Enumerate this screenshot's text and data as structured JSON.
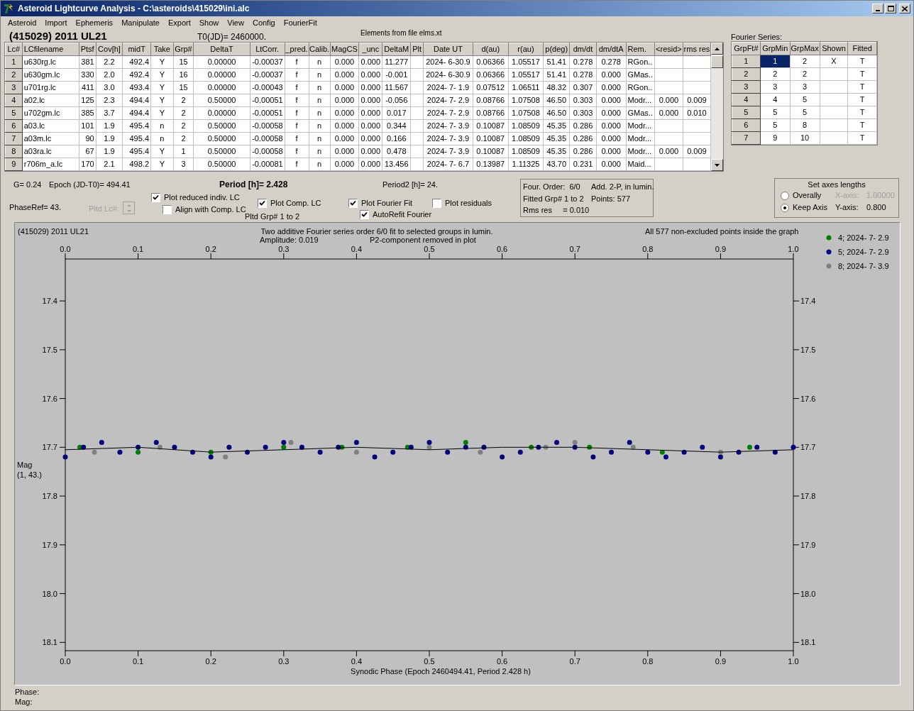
{
  "window": {
    "title": "Asteroid Lightcurve Analysis - C:\\asteroids\\415029\\ini.alc"
  },
  "menu": [
    "Asteroid",
    "Import",
    "Ephemeris",
    "Manipulate",
    "Export",
    "Show",
    "View",
    "Config",
    "FourierFit"
  ],
  "object_name": "(415029) 2011 UL21",
  "t0": "T0(JD)= 2460000.",
  "elements_note": "Elements from file elms.xt",
  "lc_table": {
    "columns": [
      "Lc#",
      "LCfilename",
      "Ptsf",
      "Cov[h]",
      "midT",
      "Take",
      "Grp#",
      "DeltaT",
      "LtCorr.",
      "_pred.",
      "Calib.",
      "MagCS",
      "_unc",
      "DeltaM",
      "Plt",
      "Date UT",
      "d(au)",
      "r(au)",
      "p(deg)",
      "dm/dt",
      "dm/dtA",
      "Rem.",
      "<resid>",
      "rms res"
    ],
    "rows": [
      [
        "1",
        "u630rg.lc",
        "381",
        "2.2",
        "492.4",
        "Y",
        "15",
        "0.00000",
        "-0.00037",
        "f",
        "n",
        "0.000",
        "0.000",
        "11.277",
        "",
        "2024- 6-30.9",
        "0.06366",
        "1.05517",
        "51.41",
        "0.278",
        "0.278",
        "RGon..",
        "",
        ""
      ],
      [
        "2",
        "u630gm.lc",
        "330",
        "2.0",
        "492.4",
        "Y",
        "16",
        "0.00000",
        "-0.00037",
        "f",
        "n",
        "0.000",
        "0.000",
        "-0.001",
        "",
        "2024- 6-30.9",
        "0.06366",
        "1.05517",
        "51.41",
        "0.278",
        "0.000",
        "GMas..",
        "",
        ""
      ],
      [
        "3",
        "u701rg.lc",
        "411",
        "3.0",
        "493.4",
        "Y",
        "15",
        "0.00000",
        "-0.00043",
        "f",
        "n",
        "0.000",
        "0.000",
        "11.567",
        "",
        "2024- 7- 1.9",
        "0.07512",
        "1.06511",
        "48.32",
        "0.307",
        "0.000",
        "RGon..",
        "",
        ""
      ],
      [
        "4",
        "a02.lc",
        "125",
        "2.3",
        "494.4",
        "Y",
        "2",
        "0.50000",
        "-0.00051",
        "f",
        "n",
        "0.000",
        "0.000",
        "-0.056",
        "",
        "2024- 7- 2.9",
        "0.08766",
        "1.07508",
        "46.50",
        "0.303",
        "0.000",
        "Modr...",
        "0.000",
        "0.009"
      ],
      [
        "5",
        "u702gm.lc",
        "385",
        "3.7",
        "494.4",
        "Y",
        "2",
        "0.00000",
        "-0.00051",
        "f",
        "n",
        "0.000",
        "0.000",
        "0.017",
        "",
        "2024- 7- 2.9",
        "0.08766",
        "1.07508",
        "46.50",
        "0.303",
        "0.000",
        "GMas..",
        "0.000",
        "0.010"
      ],
      [
        "6",
        "a03.lc",
        "101",
        "1.9",
        "495.4",
        "n",
        "2",
        "0.50000",
        "-0.00058",
        "f",
        "n",
        "0.000",
        "0.000",
        "0.344",
        "",
        "2024- 7- 3.9",
        "0.10087",
        "1.08509",
        "45.35",
        "0.286",
        "0.000",
        "Modr...",
        "",
        ""
      ],
      [
        "7",
        "a03m.lc",
        "90",
        "1.9",
        "495.4",
        "n",
        "2",
        "0.50000",
        "-0.00058",
        "f",
        "n",
        "0.000",
        "0.000",
        "0.166",
        "",
        "2024- 7- 3.9",
        "0.10087",
        "1.08509",
        "45.35",
        "0.286",
        "0.000",
        "Modr...",
        "",
        ""
      ],
      [
        "8",
        "a03ra.lc",
        "67",
        "1.9",
        "495.4",
        "Y",
        "1",
        "0.50000",
        "-0.00058",
        "f",
        "n",
        "0.000",
        "0.000",
        "0.478",
        "",
        "2024- 7- 3.9",
        "0.10087",
        "1.08509",
        "45.35",
        "0.286",
        "0.000",
        "Modr...",
        "0.000",
        "0.009"
      ],
      [
        "9",
        "r706m_a.lc",
        "170",
        "2.1",
        "498.2",
        "Y",
        "3",
        "0.50000",
        "-0.00081",
        "f",
        "n",
        "0.000",
        "0.000",
        "13.456",
        "",
        "2024- 7- 6.7",
        "0.13987",
        "1.11325",
        "43.70",
        "0.231",
        "0.000",
        "Maid...",
        "",
        ""
      ]
    ]
  },
  "fourier": {
    "label": "Fourier Series:",
    "columns": [
      "GrpFt#",
      "GrpMin",
      "GrpMax",
      "Shown",
      "Fitted"
    ],
    "rows": [
      [
        {
          "text": "1",
          "selected": false
        },
        {
          "text": "1",
          "selected": true
        },
        {
          "text": "2",
          "selected": false
        },
        {
          "text": "X",
          "selected": false
        },
        {
          "text": "T",
          "selected": false
        }
      ],
      [
        {
          "text": "2",
          "selected": false
        },
        {
          "text": "2",
          "selected": false
        },
        {
          "text": "2",
          "selected": false
        },
        {
          "text": "",
          "selected": false
        },
        {
          "text": "T",
          "selected": false
        }
      ],
      [
        {
          "text": "3",
          "selected": false
        },
        {
          "text": "3",
          "selected": false
        },
        {
          "text": "3",
          "selected": false
        },
        {
          "text": "",
          "selected": false
        },
        {
          "text": "T",
          "selected": false
        }
      ],
      [
        {
          "text": "4",
          "selected": false
        },
        {
          "text": "4",
          "selected": false
        },
        {
          "text": "5",
          "selected": false
        },
        {
          "text": "",
          "selected": false
        },
        {
          "text": "T",
          "selected": false
        }
      ],
      [
        {
          "text": "5",
          "selected": false
        },
        {
          "text": "5",
          "selected": false
        },
        {
          "text": "5",
          "selected": false
        },
        {
          "text": "",
          "selected": false
        },
        {
          "text": "T",
          "selected": false
        }
      ],
      [
        {
          "text": "6",
          "selected": false
        },
        {
          "text": "5",
          "selected": false
        },
        {
          "text": "8",
          "selected": false
        },
        {
          "text": "",
          "selected": false
        },
        {
          "text": "T",
          "selected": false
        }
      ],
      [
        {
          "text": "7",
          "selected": false
        },
        {
          "text": "9",
          "selected": false
        },
        {
          "text": "10",
          "selected": false
        },
        {
          "text": "",
          "selected": false
        },
        {
          "text": "T",
          "selected": false
        }
      ]
    ]
  },
  "info": {
    "g": "G= 0.24",
    "epoch": "Epoch (JD-T0)= 494.41",
    "period": "Period [h]= 2.428",
    "period2": "Period2 [h]= 24.",
    "phase_ref": "PhaseRef= 43.",
    "pltd_lc": "Pltd Lc#:",
    "pltd_lc_disabled": true,
    "pltd_grp": "Pltd Grp#  1  to  2"
  },
  "checkboxes": [
    {
      "label": "Plot reduced indiv. LC",
      "checked": true
    },
    {
      "label": "Align with Comp. LC",
      "checked": false
    },
    {
      "label": "Plot Comp. LC",
      "checked": true
    },
    {
      "label": "Plot Fourier Fit",
      "checked": true
    },
    {
      "label": "Plot residuals",
      "checked": false
    },
    {
      "label": "AutoRefit Fourier",
      "checked": true
    }
  ],
  "fit_summary": [
    "Four. Order:  6/0",
    "Add. 2-P, in lumin.",
    "Fitted Grp# 1 to 2",
    "Points: 577",
    "Rms res     = 0.010"
  ],
  "axes_box": {
    "title": "Set axes lengths",
    "options": [
      {
        "label": "Overally",
        "selected": false
      },
      {
        "label": "Keep Axis",
        "selected": true
      }
    ],
    "x_label": "X-axis:",
    "x_value": "1.00000",
    "x_disabled": true,
    "y_label": "Y-axis:",
    "y_value": "0.800"
  },
  "plot": {
    "object": "(415029) 2011 UL21",
    "title": "Two additive Fourier series order 6/0 fit to selected groups in lumin.",
    "amplitude": "Amplitude: 0.019",
    "note": "P2-component removed in plot",
    "points_note": "All 577 non-excluded points inside the graph",
    "ylabel_note": "(1, 43.)",
    "chart_data": {
      "type": "scatter",
      "xlabel": "Synodic Phase (Epoch 2460494.41, Period 2.428 h)",
      "ylabel": "Mag",
      "xlim": [
        0,
        1
      ],
      "ylim": [
        18.117,
        17.314
      ],
      "legend": true,
      "xticks": [
        {
          "value": 0,
          "label": "0.0"
        },
        {
          "value": 0.1,
          "label": "0.1"
        },
        {
          "value": 0.2,
          "label": "0.2"
        },
        {
          "value": 0.3,
          "label": "0.3"
        },
        {
          "value": 0.4,
          "label": "0.4"
        },
        {
          "value": 0.5,
          "label": "0.5"
        },
        {
          "value": 0.6,
          "label": "0.6"
        },
        {
          "value": 0.7,
          "label": "0.7"
        },
        {
          "value": 0.8,
          "label": "0.8"
        },
        {
          "value": 0.9,
          "label": "0.9"
        },
        {
          "value": 1,
          "label": "1.0"
        }
      ],
      "yticks": [
        {
          "value": 17.4,
          "label": "17.4"
        },
        {
          "value": 17.5,
          "label": "17.5"
        },
        {
          "value": 17.6,
          "label": "17.6"
        },
        {
          "value": 17.7,
          "label": "17.7"
        },
        {
          "value": 17.8,
          "label": "17.8"
        },
        {
          "value": 17.9,
          "label": "17.9"
        },
        {
          "value": 18.0,
          "label": "18.0"
        },
        {
          "value": 18.1,
          "label": "18.1"
        }
      ],
      "series": [
        {
          "name": "4; 2024- 7- 2.9",
          "color": "#008000",
          "x": [
            0.02,
            0.1,
            0.2,
            0.3,
            0.38,
            0.47,
            0.55,
            0.64,
            0.72,
            0.82,
            0.94
          ],
          "values": [
            17.7,
            17.71,
            17.71,
            17.7,
            17.7,
            17.7,
            17.69,
            17.7,
            17.7,
            17.71,
            17.7
          ]
        },
        {
          "name": "5; 2024- 7- 2.9",
          "color": "#000080",
          "x": [
            0,
            0.025,
            0.05,
            0.075,
            0.1,
            0.125,
            0.15,
            0.175,
            0.2,
            0.225,
            0.25,
            0.275,
            0.3,
            0.325,
            0.35,
            0.375,
            0.4,
            0.425,
            0.45,
            0.475,
            0.5,
            0.525,
            0.55,
            0.575,
            0.6,
            0.625,
            0.65,
            0.675,
            0.7,
            0.725,
            0.75,
            0.775,
            0.8,
            0.825,
            0.85,
            0.875,
            0.9,
            0.925,
            0.95,
            0.975,
            1
          ],
          "values": [
            17.72,
            17.7,
            17.69,
            17.71,
            17.7,
            17.69,
            17.7,
            17.71,
            17.72,
            17.7,
            17.71,
            17.7,
            17.69,
            17.7,
            17.71,
            17.7,
            17.69,
            17.72,
            17.71,
            17.7,
            17.69,
            17.71,
            17.7,
            17.7,
            17.72,
            17.71,
            17.7,
            17.69,
            17.7,
            17.72,
            17.71,
            17.69,
            17.71,
            17.72,
            17.71,
            17.7,
            17.72,
            17.71,
            17.7,
            17.71,
            17.7
          ]
        },
        {
          "name": "8; 2024- 7- 3.9",
          "color": "#808080",
          "x": [
            0.04,
            0.13,
            0.22,
            0.31,
            0.4,
            0.5,
            0.57,
            0.66,
            0.7,
            0.78,
            0.9
          ],
          "values": [
            17.71,
            17.7,
            17.72,
            17.69,
            17.71,
            17.7,
            17.71,
            17.7,
            17.69,
            17.7,
            17.71
          ]
        },
        {
          "type": "line",
          "color": "#000000",
          "x": [
            0,
            0.1,
            0.2,
            0.3,
            0.4,
            0.5,
            0.6,
            0.7,
            0.8,
            0.9,
            1
          ],
          "values": [
            17.705,
            17.7,
            17.71,
            17.705,
            17.7,
            17.705,
            17.7,
            17.7,
            17.705,
            17.71,
            17.705
          ]
        }
      ]
    }
  },
  "status": [
    "Phase:",
    "Mag:"
  ]
}
